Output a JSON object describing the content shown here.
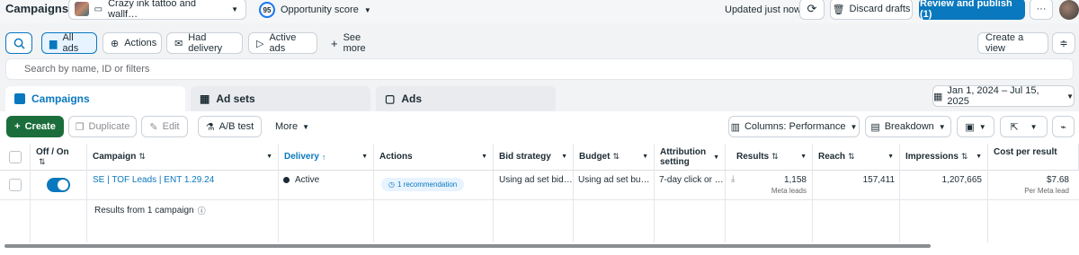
{
  "header": {
    "title": "Campaigns",
    "account_name": "Crazy ink tattoo and wallf…",
    "opportunity_score": "95",
    "opportunity_label": "Opportunity score",
    "updated_text": "Updated just now",
    "discard_label": "Discard drafts",
    "review_label": "Review and publish (1)",
    "more_label": "···"
  },
  "filters": {
    "all_ads": "All ads",
    "actions": "Actions",
    "had_delivery": "Had delivery",
    "active_ads": "Active ads",
    "see_more": "See more",
    "create_view": "Create a view"
  },
  "search": {
    "placeholder": "Search by name, ID or filters"
  },
  "tabs": [
    {
      "label": "Campaigns"
    },
    {
      "label": "Ad sets"
    },
    {
      "label": "Ads"
    }
  ],
  "date_range": "Jan 1, 2024 – Jul 15, 2025",
  "toolbar": {
    "create": "Create",
    "duplicate": "Duplicate",
    "edit": "Edit",
    "ab_test": "A/B test",
    "more": "More",
    "columns": "Columns: Performance",
    "breakdown": "Breakdown"
  },
  "table": {
    "headers": {
      "off_on": "Off / On",
      "campaign": "Campaign",
      "delivery": "Delivery",
      "actions": "Actions",
      "bid_strategy": "Bid strategy",
      "budget": "Budget",
      "attribution_1": "Attribution",
      "attribution_2": "setting",
      "results": "Results",
      "reach": "Reach",
      "impressions": "Impressions",
      "cost_per_result": "Cost per result"
    },
    "row": {
      "campaign": "SE | TOF Leads | ENT 1.29.24",
      "delivery": "Active",
      "actions": "1 recommendation",
      "bid_strategy": "Using ad set bid…",
      "budget": "Using ad set bu…",
      "attribution": "7-day click or …",
      "results": "1,158",
      "results_sub": "Meta leads",
      "reach": "157,411",
      "impressions": "1,207,665",
      "cost_per_result": "$7.68",
      "cost_sub": "Per Meta lead"
    },
    "summary": "Results from 1 campaign"
  },
  "colors": {
    "accent": "#0a78be",
    "create_button": "#1b6e3b",
    "active_dot": "#31a24c"
  }
}
